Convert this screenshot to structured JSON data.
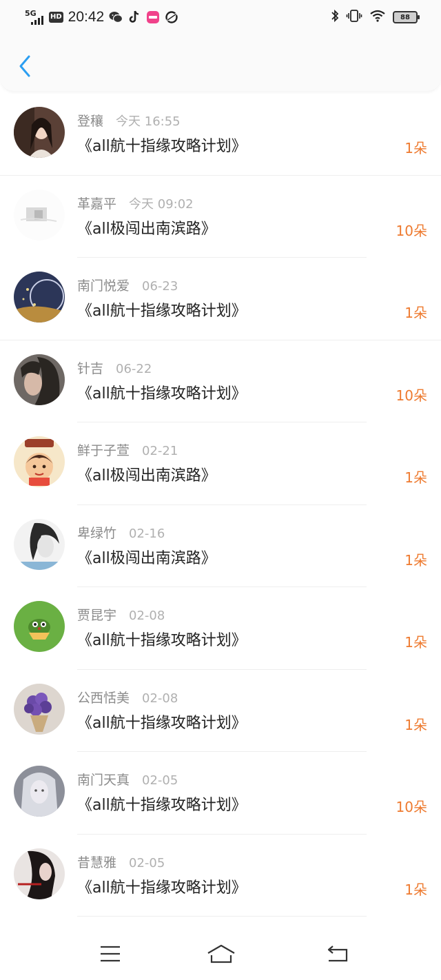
{
  "status_bar": {
    "network": "5G",
    "hd": "HD",
    "time": "20:42",
    "battery": "88",
    "app_icons": [
      "wechat-icon",
      "tiktok-icon",
      "pink-app-icon",
      "moon-app-icon"
    ],
    "right_icons": [
      "bluetooth-icon",
      "vibrate-icon",
      "wifi-icon",
      "battery-icon"
    ]
  },
  "header": {
    "back_icon": "chevron-left-icon",
    "accent": "#2b9ef1"
  },
  "records": [
    {
      "name": "登穰",
      "time": "今天 16:55",
      "title": "《all航十指缘攻略计划》",
      "amount": "1朵"
    },
    {
      "name": "革嘉平",
      "time": "今天 09:02",
      "title": "《all极闯出南滨路》",
      "amount": "10朵"
    },
    {
      "name": "南门悦爱",
      "time": "06-23",
      "title": "《all航十指缘攻略计划》",
      "amount": "1朵"
    },
    {
      "name": "针吉",
      "time": "06-22",
      "title": "《all航十指缘攻略计划》",
      "amount": "10朵"
    },
    {
      "name": "鲜于子萱",
      "time": "02-21",
      "title": "《all极闯出南滨路》",
      "amount": "1朵"
    },
    {
      "name": "卑绿竹",
      "time": "02-16",
      "title": "《all极闯出南滨路》",
      "amount": "1朵"
    },
    {
      "name": "贾昆宇",
      "time": "02-08",
      "title": "《all航十指缘攻略计划》",
      "amount": "1朵"
    },
    {
      "name": "公西恬美",
      "time": "02-08",
      "title": "《all航十指缘攻略计划》",
      "amount": "1朵"
    },
    {
      "name": "南门天真",
      "time": "02-05",
      "title": "《all航十指缘攻略计划》",
      "amount": "10朵"
    },
    {
      "name": "昔慧雅",
      "time": "02-05",
      "title": "《all航十指缘攻略计划》",
      "amount": "1朵"
    }
  ],
  "amount_color": "#ee7a2f",
  "nav": [
    "menu-icon",
    "home-icon",
    "back-icon"
  ]
}
